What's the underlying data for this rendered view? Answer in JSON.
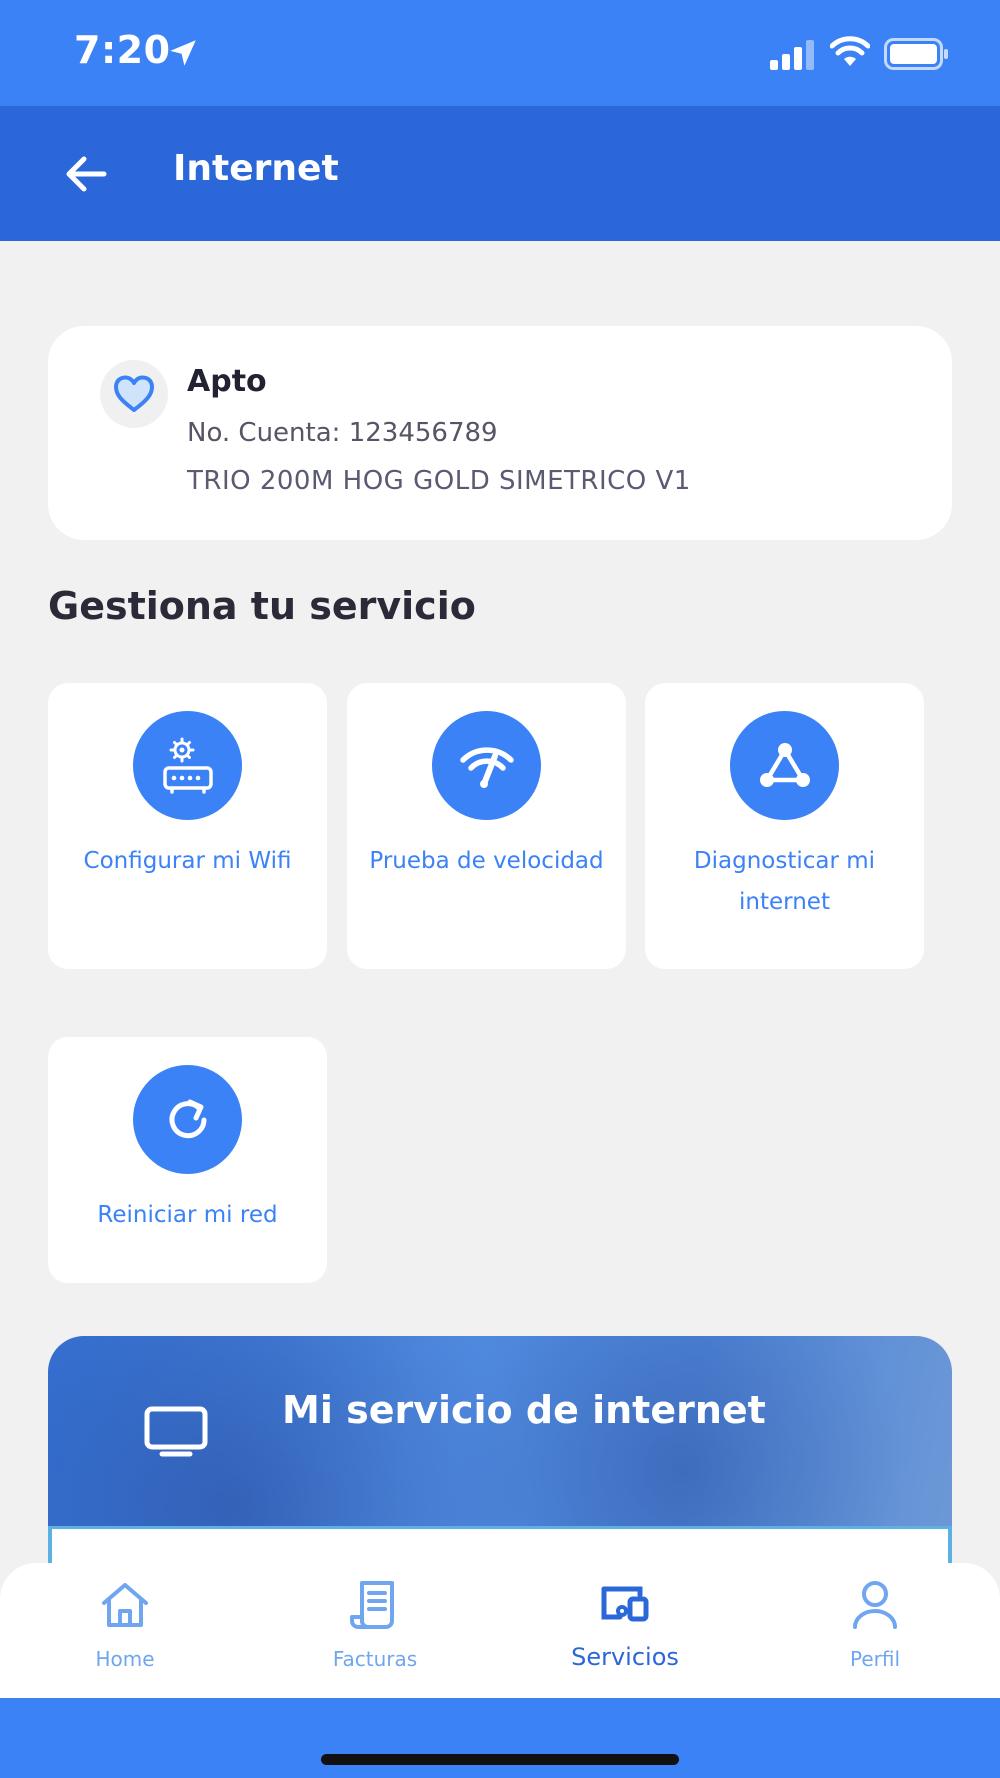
{
  "status_bar": {
    "time": "7:20"
  },
  "app_bar": {
    "title": "Internet"
  },
  "account": {
    "name": "Apto",
    "number": "No. Cuenta: 123456789",
    "plan": "TRIO 200M HOG GOLD SIMETRICO V1"
  },
  "section": {
    "title": "Gestiona tu servicio"
  },
  "actions": [
    {
      "label": "Configurar mi Wifi",
      "icon": "router-gear-icon"
    },
    {
      "label": "Prueba de velocidad",
      "icon": "speed-test-icon"
    },
    {
      "label": "Diagnosticar mi internet",
      "icon": "network-nodes-icon"
    },
    {
      "label": "Reiniciar mi red",
      "icon": "refresh-icon"
    }
  ],
  "promo": {
    "title": "Mi servicio de internet",
    "icon": "tv-icon"
  },
  "tabs": [
    {
      "label": "Home",
      "icon": "home-icon",
      "active": false
    },
    {
      "label": "Facturas",
      "icon": "invoice-icon",
      "active": false
    },
    {
      "label": "Servicios",
      "icon": "devices-icon",
      "active": true
    },
    {
      "label": "Perfil",
      "icon": "user-icon",
      "active": false
    }
  ],
  "colors": {
    "primary": "#3b82f6",
    "app_bar": "#2b67d9",
    "background": "#f1f1f1"
  }
}
